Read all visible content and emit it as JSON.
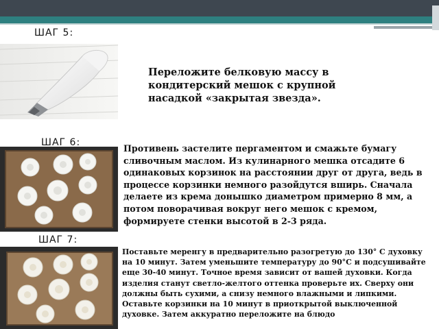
{
  "steps": [
    {
      "label": "ШАГ  5:",
      "text": "Переложите белковую массу в кондитерский мешок с крупной насадкой «закрытая звезда».",
      "image": "piping-bag-photo"
    },
    {
      "label": "ШАГ 6:",
      "text": "Противень застелите пергаментом и смажьте бумагу сливочным маслом. Из кулинарного мешка отсадите 6 одинаковых корзинок на расстоянии друг от друга, ведь в процессе корзинки немного разойдутся вширь. Сначала делаете из крема донышко диаметром примерно 8 мм, а потом поворачивая вокруг него мешок с кремом, формируете стенки высотой в 2-3 ряда.",
      "image": "meringue-tray-raw-photo"
    },
    {
      "label": "ШАГ 7:",
      "text": "Поставьте меренгу в предварительно разогретую до 130° С духовку на 10 минут. Затем уменьшите температуру до 90°С и подсушивайте еще 30-40 минут. Точное время зависит от вашей духовки. Когда изделия станут светло-желтого оттенка проверьте их. Сверху они должны быть сухими, а снизу немного влажными и липкими. Оставьте корзинки на 10 минут в приоткрытой выключенной духовке. Затем аккуратно переложите на блюдо",
      "image": "meringue-tray-baked-photo"
    }
  ],
  "colors": {
    "header_dark": "#3e4750",
    "header_teal": "#2e8080",
    "tray": "#2b2b2b",
    "parchment": "#8a6a4a"
  }
}
